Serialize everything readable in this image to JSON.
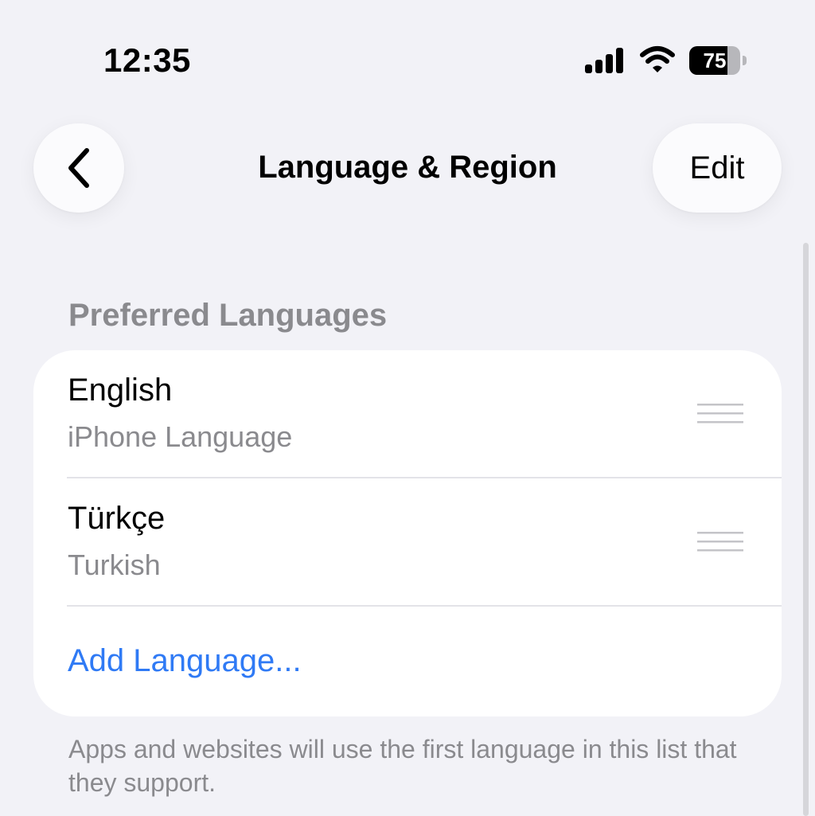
{
  "status_bar": {
    "time": "12:35",
    "battery_level": "75",
    "battery_fraction": 0.75,
    "icons": [
      "signal-icon",
      "wifi-icon",
      "battery-icon"
    ]
  },
  "nav": {
    "title": "Language & Region",
    "edit_label": "Edit",
    "back_icon": "chevron-left-icon"
  },
  "section": {
    "header": "Preferred Languages",
    "languages": [
      {
        "name": "English",
        "subtitle": "iPhone Language"
      },
      {
        "name": "Türkçe",
        "subtitle": "Turkish"
      }
    ],
    "add_label": "Add Language...",
    "footer": "Apps and websites will use the first language in this list that they support."
  },
  "colors": {
    "background": "#f2f2f7",
    "accent": "#2f7af5",
    "secondary_text": "#8a8a8e"
  }
}
